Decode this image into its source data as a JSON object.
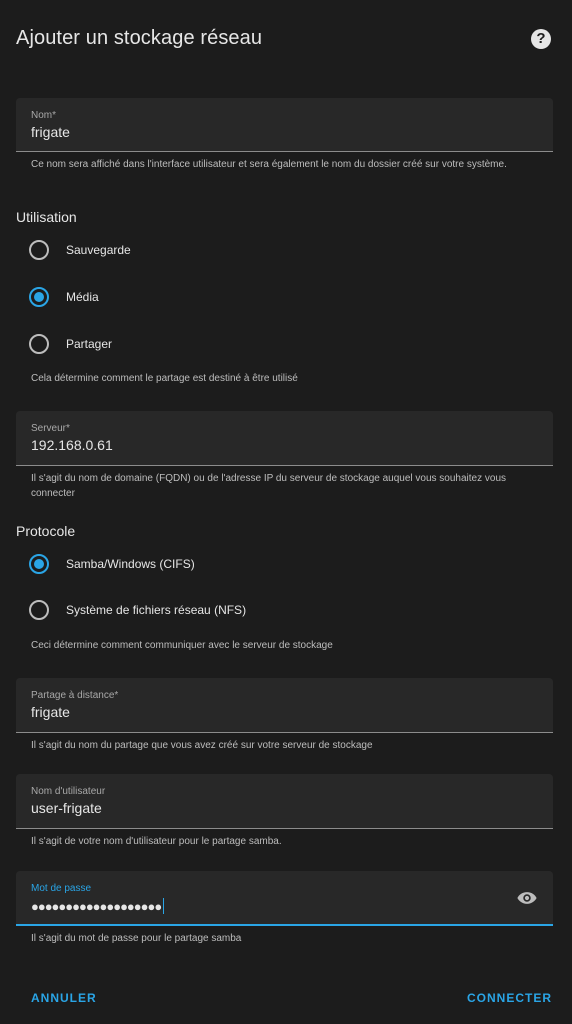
{
  "dialog": {
    "title": "Ajouter un stockage réseau",
    "help_icon": "question-circle-icon"
  },
  "name_field": {
    "label": "Nom*",
    "value": "frigate",
    "helper": "Ce nom sera affiché dans l'interface utilisateur et sera également le nom du dossier créé sur votre système."
  },
  "usage": {
    "heading": "Utilisation",
    "options": [
      {
        "label": "Sauvegarde",
        "checked": false
      },
      {
        "label": "Média",
        "checked": true
      },
      {
        "label": "Partager",
        "checked": false
      }
    ],
    "helper": "Cela détermine comment le partage est destiné à être utilisé"
  },
  "server_field": {
    "label": "Serveur*",
    "value": "192.168.0.61",
    "helper": "Il s'agit du nom de domaine (FQDN) ou de l'adresse IP du serveur de stockage auquel vous souhaitez vous connecter"
  },
  "protocol": {
    "heading": "Protocole",
    "options": [
      {
        "label": "Samba/Windows (CIFS)",
        "checked": true
      },
      {
        "label": "Système de fichiers réseau (NFS)",
        "checked": false
      }
    ],
    "helper": "Ceci détermine comment communiquer avec le serveur de stockage"
  },
  "remote_share_field": {
    "label": "Partage à distance*",
    "value": "frigate",
    "helper": "Il s'agit du nom du partage que vous avez créé sur votre serveur de stockage"
  },
  "username_field": {
    "label": "Nom d'utilisateur",
    "value": "user-frigate",
    "helper": "Il s'agit de votre nom d'utilisateur pour le partage samba."
  },
  "password_field": {
    "label": "Mot de passe",
    "value": "●●●●●●●●●●●●●●●●●●●",
    "toggle_icon": "eye-icon",
    "helper": "Il s'agit du mot de passe pour le partage samba"
  },
  "actions": {
    "cancel": "ANNULER",
    "connect": "CONNECTER"
  },
  "colors": {
    "accent": "#2aa5e6",
    "surface": "#1c1c1c",
    "field": "#282828"
  }
}
